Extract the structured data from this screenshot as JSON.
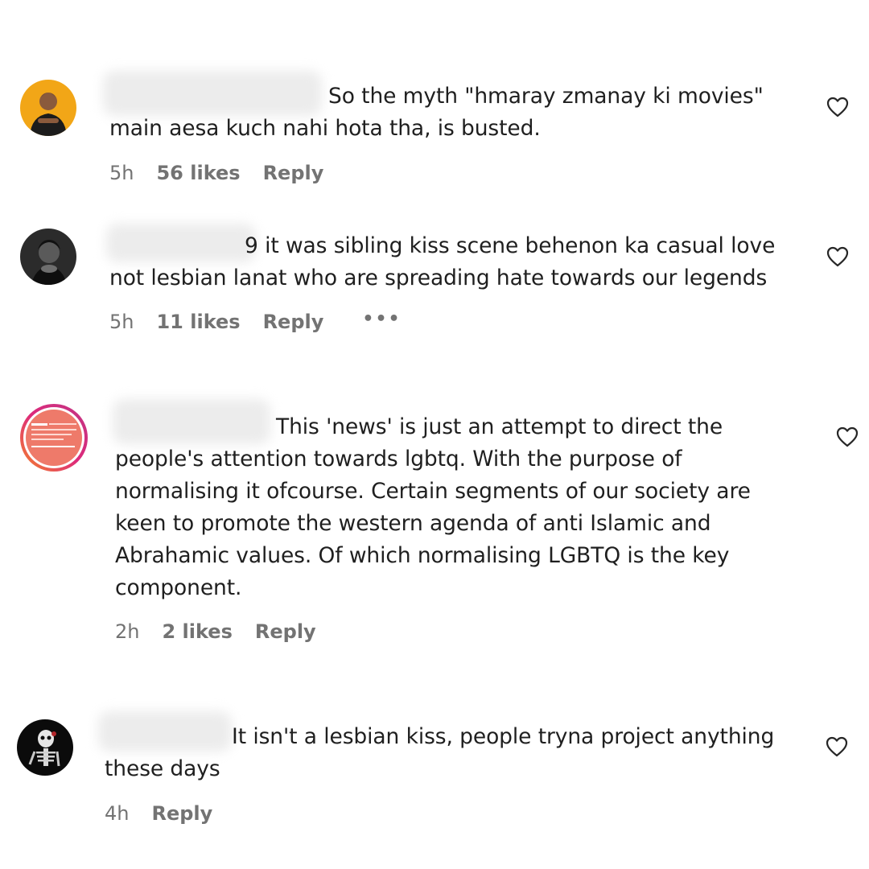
{
  "comments": [
    {
      "text": "So the myth \"hmaray zmanay ki movies\" main aesa kuch nahi hota tha, is busted.",
      "time": "5h",
      "likes": "56 likes",
      "reply": "Reply",
      "avatar_icon": "person-avatar",
      "heart_icon": "heart-outline-icon"
    },
    {
      "text_visible_prefix": "9",
      "text": "it was sibling kiss scene behenon ka casual love not lesbian lanat who are spreading hate towards our legends",
      "time": "5h",
      "likes": "11 likes",
      "reply": "Reply",
      "more": "•••",
      "avatar_icon": "person-avatar",
      "heart_icon": "heart-outline-icon"
    },
    {
      "text": "This 'news' is just an attempt to direct the people's attention towards lgbtq. With the purpose of normalising it ofcourse. Certain segments of our society are keen to promote the western agenda of anti Islamic and Abrahamic values. Of which normalising LGBTQ is the key component.",
      "time": "2h",
      "likes": "2 likes",
      "reply": "Reply",
      "avatar_icon": "story-ring-avatar",
      "heart_icon": "heart-outline-icon"
    },
    {
      "text": "It isn't a lesbian kiss, people tryna project anything these days",
      "time": "4h",
      "reply": "Reply",
      "avatar_icon": "skeleton-avatar",
      "heart_icon": "heart-outline-icon"
    }
  ],
  "colors": {
    "text": "#1f1f1f",
    "meta": "#737373",
    "story_ring_start": "#f58529",
    "story_ring_end": "#dd2a7b"
  }
}
